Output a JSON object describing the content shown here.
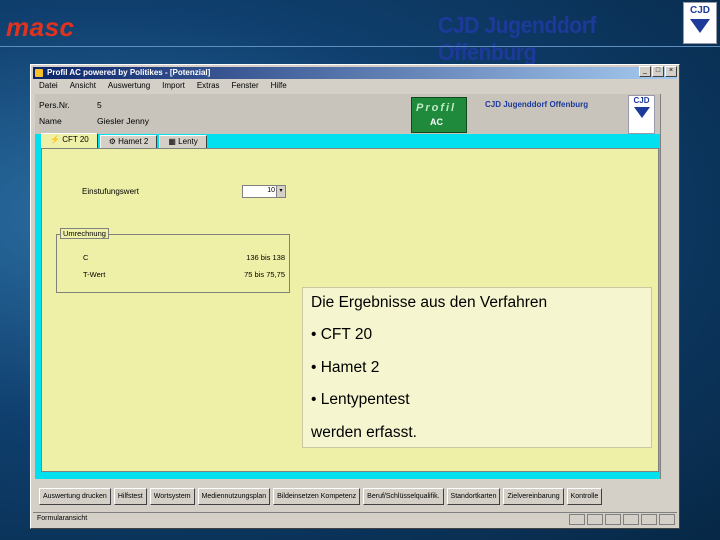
{
  "slide": {
    "logo_text": "masc",
    "brand_text": "CJD Jugenddorf Offenburg",
    "brand_logo_text": "CJD"
  },
  "window": {
    "title": "Profil AC powered by Politikes - [Potenzial]",
    "title_buttons": [
      "_",
      "□",
      "×"
    ],
    "menu": [
      "Datei",
      "Ansicht",
      "Auswertung",
      "Import",
      "Extras",
      "Fenster",
      "Hilfe"
    ],
    "header": {
      "pers_label": "Pers.Nr.",
      "pers_value": "5",
      "name_label": "Name",
      "name_value": "Giesler Jenny",
      "profil_logo": "Profil",
      "profil_logo_sub": "AC",
      "cjd_text": "CJD Jugenddorf Offenburg",
      "cjd_logo": "CJD"
    },
    "tabs": [
      "CFT 20",
      "Hamet 2",
      "Lenty"
    ],
    "form": {
      "field_label": "Einstufungswert",
      "field_value": "10",
      "group_title": "Umrechnung",
      "rows": [
        {
          "label": "C",
          "value": "136 bis 138"
        },
        {
          "label": "T-Wert",
          "value": "75 bis 75,75"
        }
      ]
    },
    "bottom_buttons": [
      "Auswertung drucken",
      "Hilfstest",
      "Wortsystem",
      "Mediennutzungsplan",
      "Bildeinsetzen Kompetenz",
      "Beruf/Schlüsselqualifik.",
      "Standortkarten",
      "Zielvereinbarung",
      "Kontrolle"
    ],
    "status_text": "Formularansicht"
  },
  "overlay": {
    "intro": "Die Ergebnisse aus den Verfahren",
    "items": [
      "• CFT 20",
      "• Hamet 2",
      "• Lentypentest"
    ],
    "outro": "werden erfasst."
  }
}
